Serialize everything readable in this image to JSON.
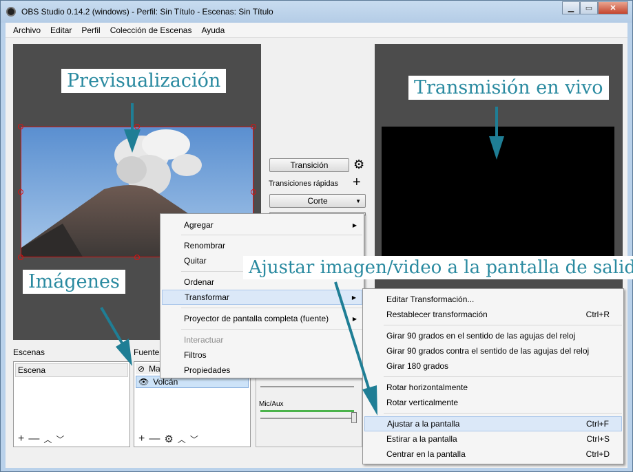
{
  "window": {
    "title": "OBS Studio 0.14.2 (windows) - Perfil: Sin Título - Escenas: Sin Título",
    "minimize": "▁",
    "maximize": "▭",
    "close": "✕"
  },
  "menubar": [
    "Archivo",
    "Editar",
    "Perfil",
    "Colección de Escenas",
    "Ayuda"
  ],
  "callouts": {
    "preview": "Previsualización",
    "live": "Transmisión en vivo",
    "images": "Imágenes",
    "fit": "Ajustar imagen/video a la pantalla de salida"
  },
  "transitions": {
    "transition_button": "Transición",
    "quick_label": "Transiciones rápidas",
    "cut_dropdown": "Corte"
  },
  "scenes": {
    "label": "Escenas",
    "items": [
      "Escena"
    ]
  },
  "sources": {
    "label": "Fuentes",
    "items": [
      "Ma",
      "Volcán"
    ]
  },
  "mixer": {
    "mic_label": "Mic/Aux"
  },
  "context_menu": {
    "items": [
      "Agregar",
      "Renombrar",
      "Quitar",
      "Ordenar",
      "Transformar",
      "Proyector de pantalla completa (fuente)",
      "Interactuar",
      "Filtros",
      "Propiedades"
    ]
  },
  "transform_menu": {
    "items": [
      {
        "label": "Editar Transformación...",
        "shortcut": ""
      },
      {
        "label": "Restablecer transformación",
        "shortcut": "Ctrl+R"
      },
      {
        "label": "Girar 90 grados en el sentido de las agujas del reloj",
        "shortcut": ""
      },
      {
        "label": "Girar 90 grados contra el sentido de las agujas del reloj",
        "shortcut": ""
      },
      {
        "label": "Girar 180 grados",
        "shortcut": ""
      },
      {
        "label": "Rotar horizontalmente",
        "shortcut": ""
      },
      {
        "label": "Rotar verticalmente",
        "shortcut": ""
      },
      {
        "label": "Ajustar a la pantalla",
        "shortcut": "Ctrl+F"
      },
      {
        "label": "Estirar a la pantalla",
        "shortcut": "Ctrl+S"
      },
      {
        "label": "Centrar en la pantalla",
        "shortcut": "Ctrl+D"
      }
    ]
  },
  "colors": {
    "callout_text": "#2a8aa0",
    "arrow": "#1f7e95",
    "selection_border": "#dd1111"
  }
}
